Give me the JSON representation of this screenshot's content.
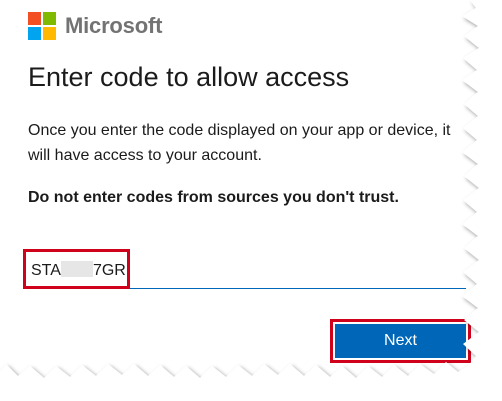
{
  "brand": {
    "name": "Microsoft",
    "logo_colors": [
      "#f25022",
      "#7fba00",
      "#00a4ef",
      "#ffb900"
    ]
  },
  "heading": "Enter code to allow access",
  "description": "Once you enter the code displayed on your app or device, it will have access to your account.",
  "warning": "Do not enter codes from sources you don't trust.",
  "code_input": {
    "value_start": "STA",
    "value_end": "7GR",
    "redacted": true
  },
  "next_button": {
    "label": "Next"
  },
  "colors": {
    "accent": "#0067b8",
    "highlight": "#d0021b"
  }
}
